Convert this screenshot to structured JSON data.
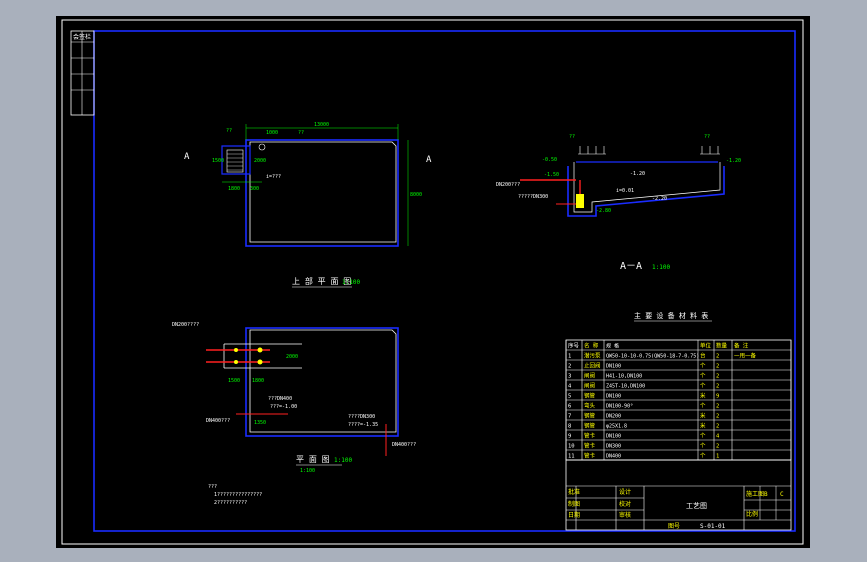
{
  "drawing": {
    "top_plan": {
      "title": "上 部 平 面 图",
      "scale": "1:100",
      "section_mark_left": "A",
      "section_mark_right": "A",
      "dim_overall_width": "13000",
      "dim_overall_height": "8000",
      "dim_left_width": "1800",
      "dim_left_gap": "300",
      "dim_height_inner": "1500",
      "dim_upper": "1000",
      "dim_inner_v": "2000",
      "lbl_grate": "??",
      "lbl_top": "??",
      "lbl_slope": "i=???",
      "lbl_small": "????"
    },
    "section": {
      "title": "A－A",
      "scale": "1:100",
      "lbl_rail_left": "??",
      "lbl_rail_right": "??",
      "lbl_level1": "-0.50",
      "lbl_level2": "-1.50",
      "lbl_level3": "-2.80",
      "lbl_level4": "-1.20",
      "lbl_pipe_in": "DN200???",
      "lbl_pipe_note": "?????DN300",
      "lbl_water": "-1.20",
      "lbl_bottom": "-2.20",
      "lbl_slope": "i=0.01"
    },
    "lower_plan": {
      "title": "平 面 图",
      "scale": "1:100",
      "scale_sub": "1:100",
      "lbl_pump": "DN200????",
      "lbl_inlet": "DN400???",
      "lbl_outlet": "DN400???",
      "lbl_note1": "???DN400",
      "lbl_note2": "???=-1.00",
      "lbl_note3": "????DN300",
      "lbl_note4": "????=-1.35",
      "dim_1800": "1800",
      "dim_1500": "1500",
      "dim_2000": "2000",
      "dim_1350": "1350",
      "note_title": "???",
      "note1": "1???????????????",
      "note2": "2??????????"
    },
    "equipment_table": {
      "title": "主 要 设 备 材 料 表",
      "headers": [
        "序号",
        "名 称",
        "规 格",
        "单位",
        "数量",
        "备 注"
      ],
      "rows": [
        [
          "1",
          "潜污泵",
          "QW50-10-10-0.75(QW50-18-7-0.75)",
          "台",
          "2",
          "一用一备"
        ],
        [
          "2",
          "止回阀",
          "DN100",
          "个",
          "2",
          ""
        ],
        [
          "3",
          "闸阀",
          "H41-10,DN100",
          "个",
          "2",
          ""
        ],
        [
          "4",
          "闸阀",
          "Z45T-10,DN100",
          "个",
          "2",
          ""
        ],
        [
          "5",
          "钢管",
          "DN100",
          "米",
          "9",
          ""
        ],
        [
          "6",
          "弯头",
          "DN100-90°",
          "个",
          "2",
          ""
        ],
        [
          "7",
          "钢管",
          "DN200",
          "米",
          "2",
          ""
        ],
        [
          "8",
          "钢管",
          "φ25X1.8",
          "米",
          "2",
          ""
        ],
        [
          "9",
          "管卡",
          "DN100",
          "个",
          "4",
          ""
        ],
        [
          "10",
          "管卡",
          "DN300",
          "个",
          "2",
          ""
        ],
        [
          "11",
          "管卡",
          "DN400",
          "个",
          "1",
          ""
        ]
      ]
    },
    "title_block": {
      "project": "工艺图",
      "drawing_no": "S-01-01",
      "label_design": "设计",
      "label_check": "校对",
      "label_review": "审核",
      "label_approve": "批准",
      "label_draw": "制图",
      "label_figno": "图号",
      "label_scale": "比例",
      "label_date": "日期",
      "label_stage": "施工图",
      "cell_b": "B",
      "cell_c": "C"
    },
    "revision_table": {
      "header": "会签栏"
    }
  }
}
